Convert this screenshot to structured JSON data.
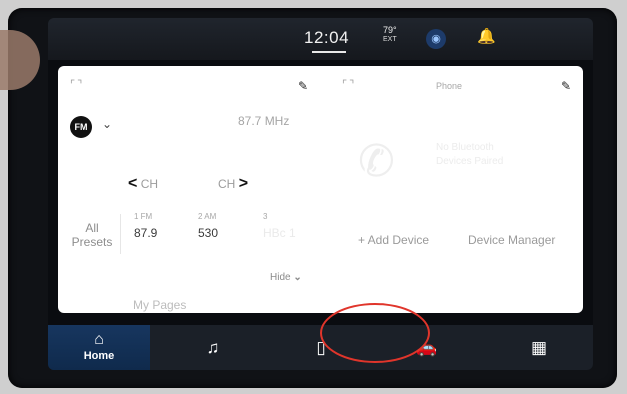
{
  "status": {
    "time": "12:04",
    "temp": "79°",
    "temp_sub": "EXT"
  },
  "radio": {
    "band": "FM",
    "frequency": "87.7 MHz",
    "ch_prev": "CH",
    "ch_next": "CH",
    "presets_label": "All Presets",
    "presets": [
      {
        "label": "1 FM",
        "value": "87.9"
      },
      {
        "label": "2 AM",
        "value": "530"
      },
      {
        "label": "3",
        "value": "HBc 1"
      }
    ]
  },
  "phone": {
    "title": "Phone",
    "add_device": "+ Add Device",
    "device_manager": "Device Manager",
    "ghost_line1": "No Bluetooth",
    "ghost_line2": "Devices Paired"
  },
  "panel": {
    "hide": "Hide",
    "my_pages": "My Pages"
  },
  "nav": {
    "home": "Home"
  },
  "colors": {
    "nav_bg": "#1b2028",
    "home_active": "#17365f",
    "highlight": "#e0352b"
  },
  "icons": [
    "expand-icon",
    "pencil-icon",
    "chevron-down-icon",
    "phone-icon",
    "bell-icon",
    "voice-icon",
    "home-icon",
    "music-icon",
    "phone-device-icon",
    "car-icon",
    "apps-grid-icon"
  ]
}
